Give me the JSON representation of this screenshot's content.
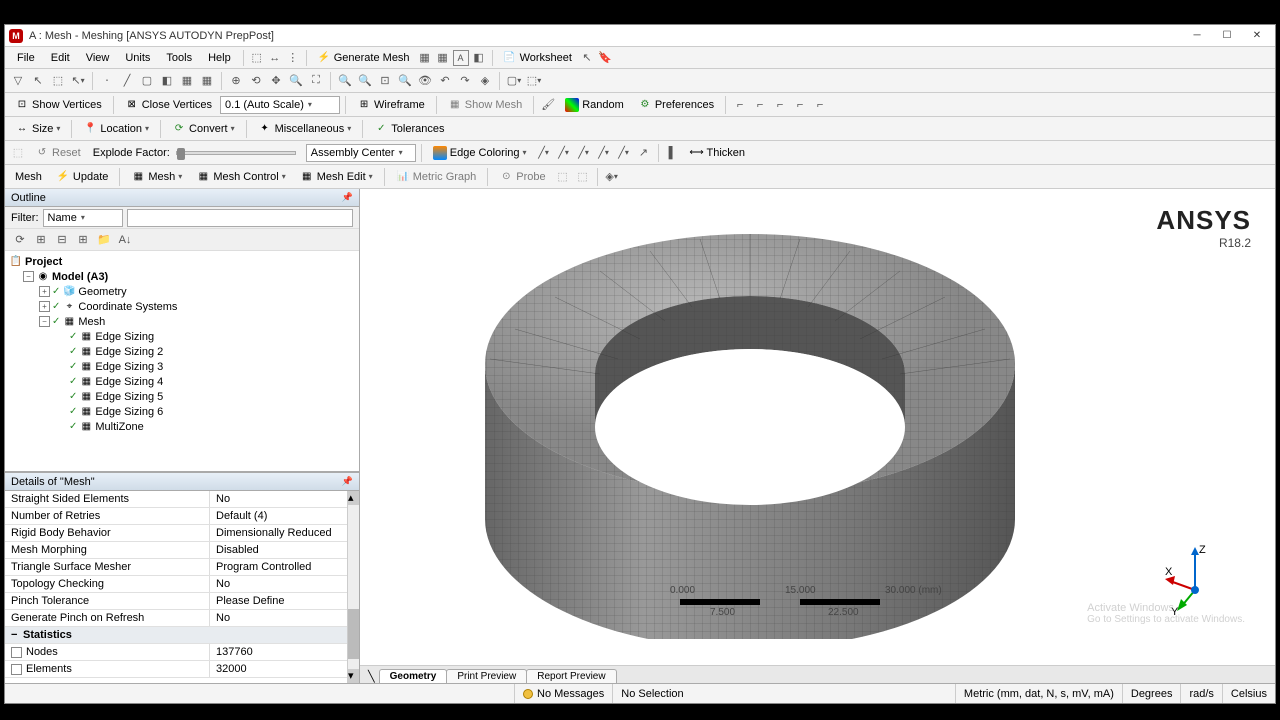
{
  "window": {
    "title": "A : Mesh - Meshing [ANSYS AUTODYN PrepPost]"
  },
  "menus": [
    "File",
    "Edit",
    "View",
    "Units",
    "Tools",
    "Help"
  ],
  "toolbar1": {
    "generate_mesh": "Generate Mesh",
    "worksheet": "Worksheet"
  },
  "toolbar3": {
    "show_vertices": "Show Vertices",
    "close_vertices": "Close Vertices",
    "scale": "0.1 (Auto Scale)",
    "wireframe": "Wireframe",
    "show_mesh": "Show Mesh",
    "random": "Random",
    "preferences": "Preferences"
  },
  "toolbar4": {
    "size": "Size",
    "location": "Location",
    "convert": "Convert",
    "misc": "Miscellaneous",
    "tolerances": "Tolerances"
  },
  "toolbar5": {
    "reset": "Reset",
    "explode_factor": "Explode Factor:",
    "assembly_center": "Assembly Center",
    "edge_coloring": "Edge Coloring",
    "thicken": "Thicken"
  },
  "toolbar6": {
    "mesh_ctx": "Mesh",
    "update": "Update",
    "mesh": "Mesh",
    "mesh_control": "Mesh Control",
    "mesh_edit": "Mesh Edit",
    "metric_graph": "Metric Graph",
    "probe": "Probe"
  },
  "outline": {
    "title": "Outline",
    "filter_label": "Filter:",
    "filter_value": "Name",
    "tree": {
      "project": "Project",
      "model": "Model (A3)",
      "geometry": "Geometry",
      "coord": "Coordinate Systems",
      "mesh": "Mesh",
      "sizings": [
        "Edge Sizing",
        "Edge Sizing 2",
        "Edge Sizing 3",
        "Edge Sizing 4",
        "Edge Sizing 5",
        "Edge Sizing 6"
      ],
      "multizone": "MultiZone"
    }
  },
  "details": {
    "title": "Details of \"Mesh\"",
    "rows": [
      {
        "k": "Straight Sided Elements",
        "v": "No"
      },
      {
        "k": "Number of Retries",
        "v": "Default (4)"
      },
      {
        "k": "Rigid Body Behavior",
        "v": "Dimensionally Reduced"
      },
      {
        "k": "Mesh Morphing",
        "v": "Disabled"
      },
      {
        "k": "Triangle Surface Mesher",
        "v": "Program Controlled"
      },
      {
        "k": "Topology Checking",
        "v": "No"
      },
      {
        "k": "Pinch Tolerance",
        "v": "Please Define"
      },
      {
        "k": "Generate Pinch on Refresh",
        "v": "No"
      }
    ],
    "stats_header": "Statistics",
    "stats": [
      {
        "k": "Nodes",
        "v": "137760"
      },
      {
        "k": "Elements",
        "v": "32000"
      }
    ]
  },
  "viewport": {
    "brand": "ANSYS",
    "version": "R18.2",
    "tabs": [
      "Geometry",
      "Print Preview",
      "Report Preview"
    ],
    "scale_labels": [
      "0.000",
      "15.000",
      "30.000 (mm)",
      "7.500",
      "22.500"
    ],
    "triad": {
      "x": "X",
      "y": "Y",
      "z": "Z"
    },
    "watermark1": "Activate Windows",
    "watermark2": "Go to Settings to activate Windows."
  },
  "status": {
    "messages": "No Messages",
    "selection": "No Selection",
    "units": "Metric (mm, dat, N, s, mV, mA)",
    "degrees": "Degrees",
    "rads": "rad/s",
    "celsius": "Celsius"
  }
}
